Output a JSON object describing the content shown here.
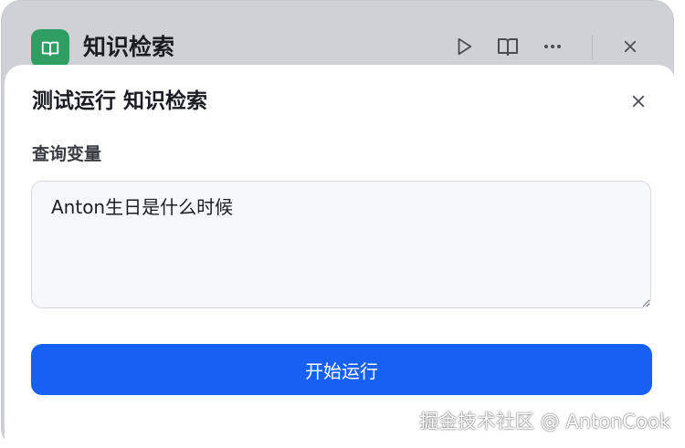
{
  "node": {
    "title": "知识检索",
    "icon": "book-icon",
    "accent_color": "#2f9e62",
    "actions": [
      "play-icon",
      "book-open-icon",
      "more-icon",
      "close-icon"
    ]
  },
  "dialog": {
    "title": "测试运行 知识检索",
    "close_icon": "close-icon",
    "field_label": "查询变量",
    "query_value": "Anton生日是什么时候",
    "run_label": "开始运行",
    "run_color": "#1760f2"
  },
  "watermark": "掘金技术社区 @ AntonCook"
}
